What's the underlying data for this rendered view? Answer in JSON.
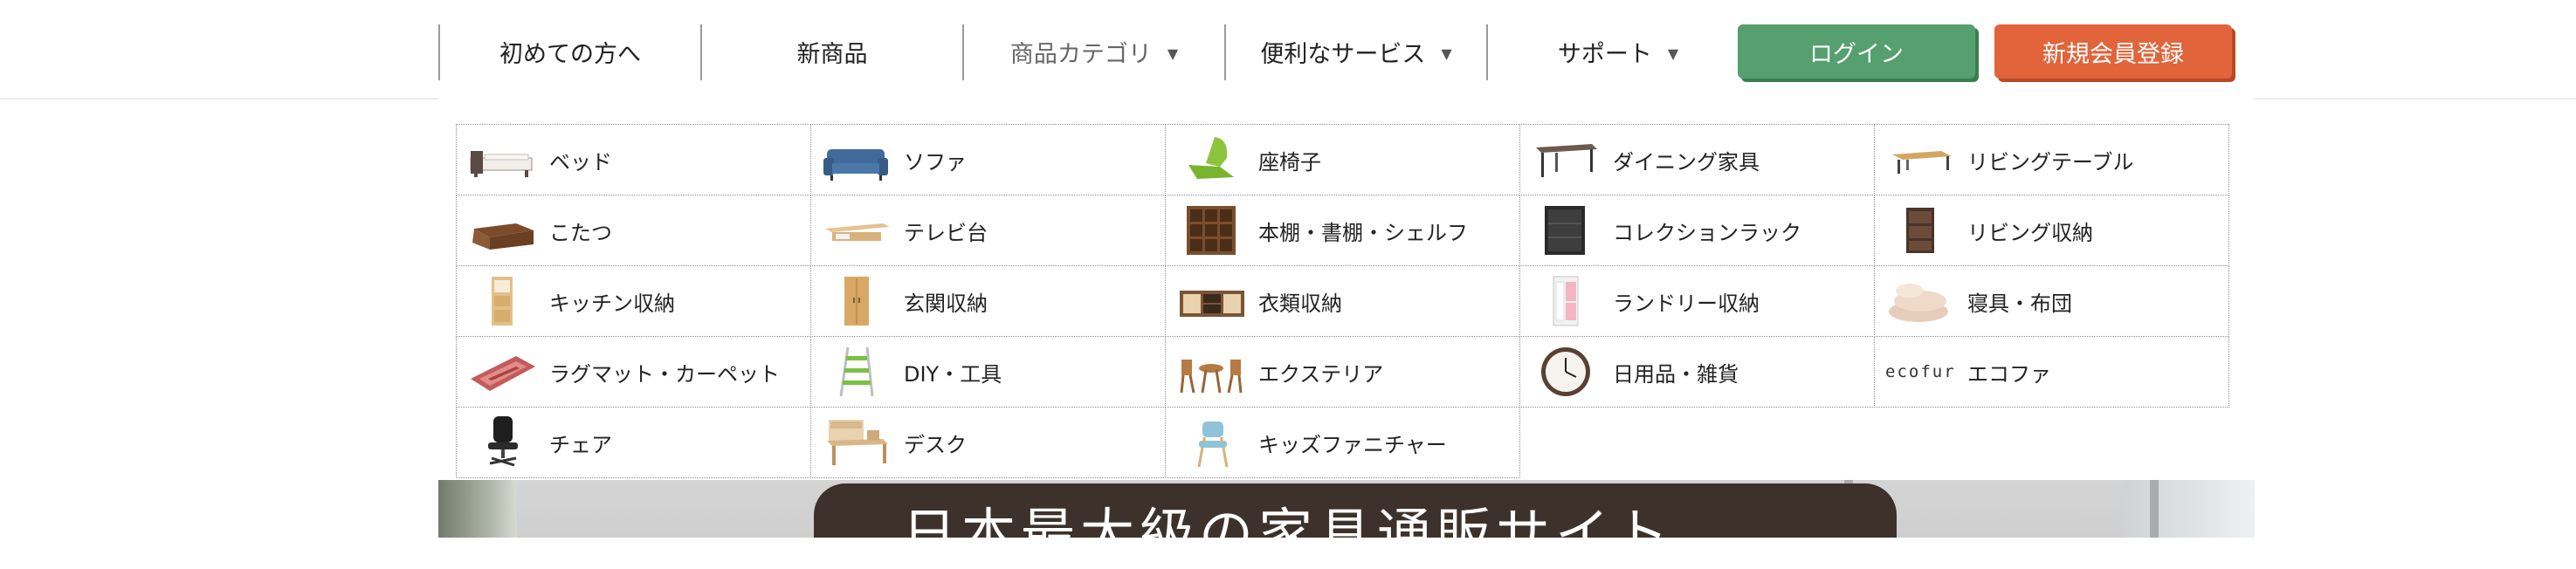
{
  "nav": {
    "items": [
      {
        "label": "初めての方へ",
        "dropdown": false
      },
      {
        "label": "新商品",
        "dropdown": false
      },
      {
        "label": "商品カテゴリ",
        "dropdown": true,
        "active": true
      },
      {
        "label": "便利なサービス",
        "dropdown": true
      },
      {
        "label": "サポート",
        "dropdown": true
      }
    ],
    "caret": "▼"
  },
  "auth": {
    "login_label": "ログイン",
    "register_label": "新規会員登録",
    "login_color": "#55a06e",
    "register_color": "#e2643b"
  },
  "hero": {
    "title": "日本最大級の家具通販サイト"
  },
  "categories": {
    "rows": [
      [
        {
          "label": "ベッド",
          "icon": "bed-icon"
        },
        {
          "label": "ソファ",
          "icon": "sofa-icon"
        },
        {
          "label": "座椅子",
          "icon": "floor-chair-icon"
        },
        {
          "label": "ダイニング家具",
          "icon": "dining-table-icon"
        },
        {
          "label": "リビングテーブル",
          "icon": "living-table-icon"
        }
      ],
      [
        {
          "label": "こたつ",
          "icon": "kotatsu-icon"
        },
        {
          "label": "テレビ台",
          "icon": "tv-stand-icon"
        },
        {
          "label": "本棚・書棚・シェルフ",
          "icon": "bookshelf-icon"
        },
        {
          "label": "コレクションラック",
          "icon": "collection-rack-icon"
        },
        {
          "label": "リビング収納",
          "icon": "living-storage-icon"
        }
      ],
      [
        {
          "label": "キッチン収納",
          "icon": "kitchen-storage-icon"
        },
        {
          "label": "玄関収納",
          "icon": "entrance-storage-icon"
        },
        {
          "label": "衣類収納",
          "icon": "clothes-storage-icon"
        },
        {
          "label": "ランドリー収納",
          "icon": "laundry-storage-icon"
        },
        {
          "label": "寝具・布団",
          "icon": "futon-icon"
        }
      ],
      [
        {
          "label": "ラグマット・カーペット",
          "icon": "rug-icon"
        },
        {
          "label": "DIY・工具",
          "icon": "ladder-icon"
        },
        {
          "label": "エクステリア",
          "icon": "garden-furniture-icon"
        },
        {
          "label": "日用品・雑貨",
          "icon": "clock-icon"
        },
        {
          "label": "エコファ",
          "icon": "ecofur-logo",
          "logo_text": "ecofur"
        }
      ],
      [
        {
          "label": "チェア",
          "icon": "office-chair-icon"
        },
        {
          "label": "デスク",
          "icon": "desk-icon"
        },
        {
          "label": "キッズファニチャー",
          "icon": "kids-chair-icon"
        }
      ]
    ]
  }
}
